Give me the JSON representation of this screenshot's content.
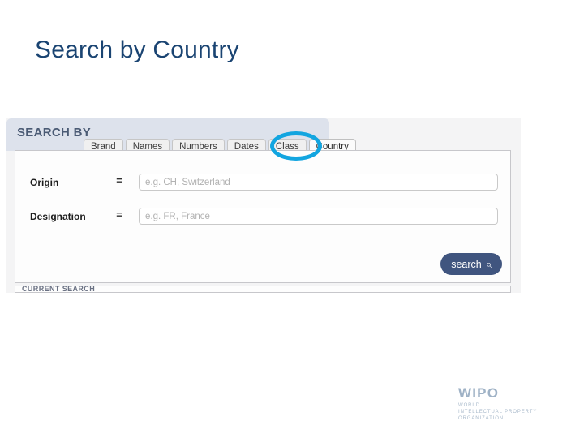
{
  "slide": {
    "title": "Search by Country",
    "title_color": "#1a4472"
  },
  "search_panel": {
    "header_label": "SEARCH BY",
    "header_bg": "#dde2ec",
    "tabs": [
      {
        "label": "Brand",
        "active": false
      },
      {
        "label": "Names",
        "active": false
      },
      {
        "label": "Numbers",
        "active": false
      },
      {
        "label": "Dates",
        "active": false
      },
      {
        "label": "Class",
        "active": false
      },
      {
        "label": "Country",
        "active": true
      }
    ],
    "annotation": {
      "shape": "ellipse",
      "color": "#12a5e0",
      "targets": "Country"
    },
    "fields": [
      {
        "label": "Origin",
        "operator": "=",
        "value": "",
        "placeholder": "e.g. CH, Switzerland"
      },
      {
        "label": "Designation",
        "operator": "=",
        "value": "",
        "placeholder": "e.g. FR, France"
      }
    ],
    "search_button": {
      "label": "search",
      "icon": "magnifier-icon",
      "bg": "#40557f"
    },
    "clipped_row_text": "CURRENT SEARCH"
  },
  "footer": {
    "logo_mark": "WIPO",
    "logo_line1": "WORLD",
    "logo_line2": "INTELLECTUAL PROPERTY",
    "logo_line3": "ORGANIZATION",
    "logo_color": "#a9bacb"
  }
}
